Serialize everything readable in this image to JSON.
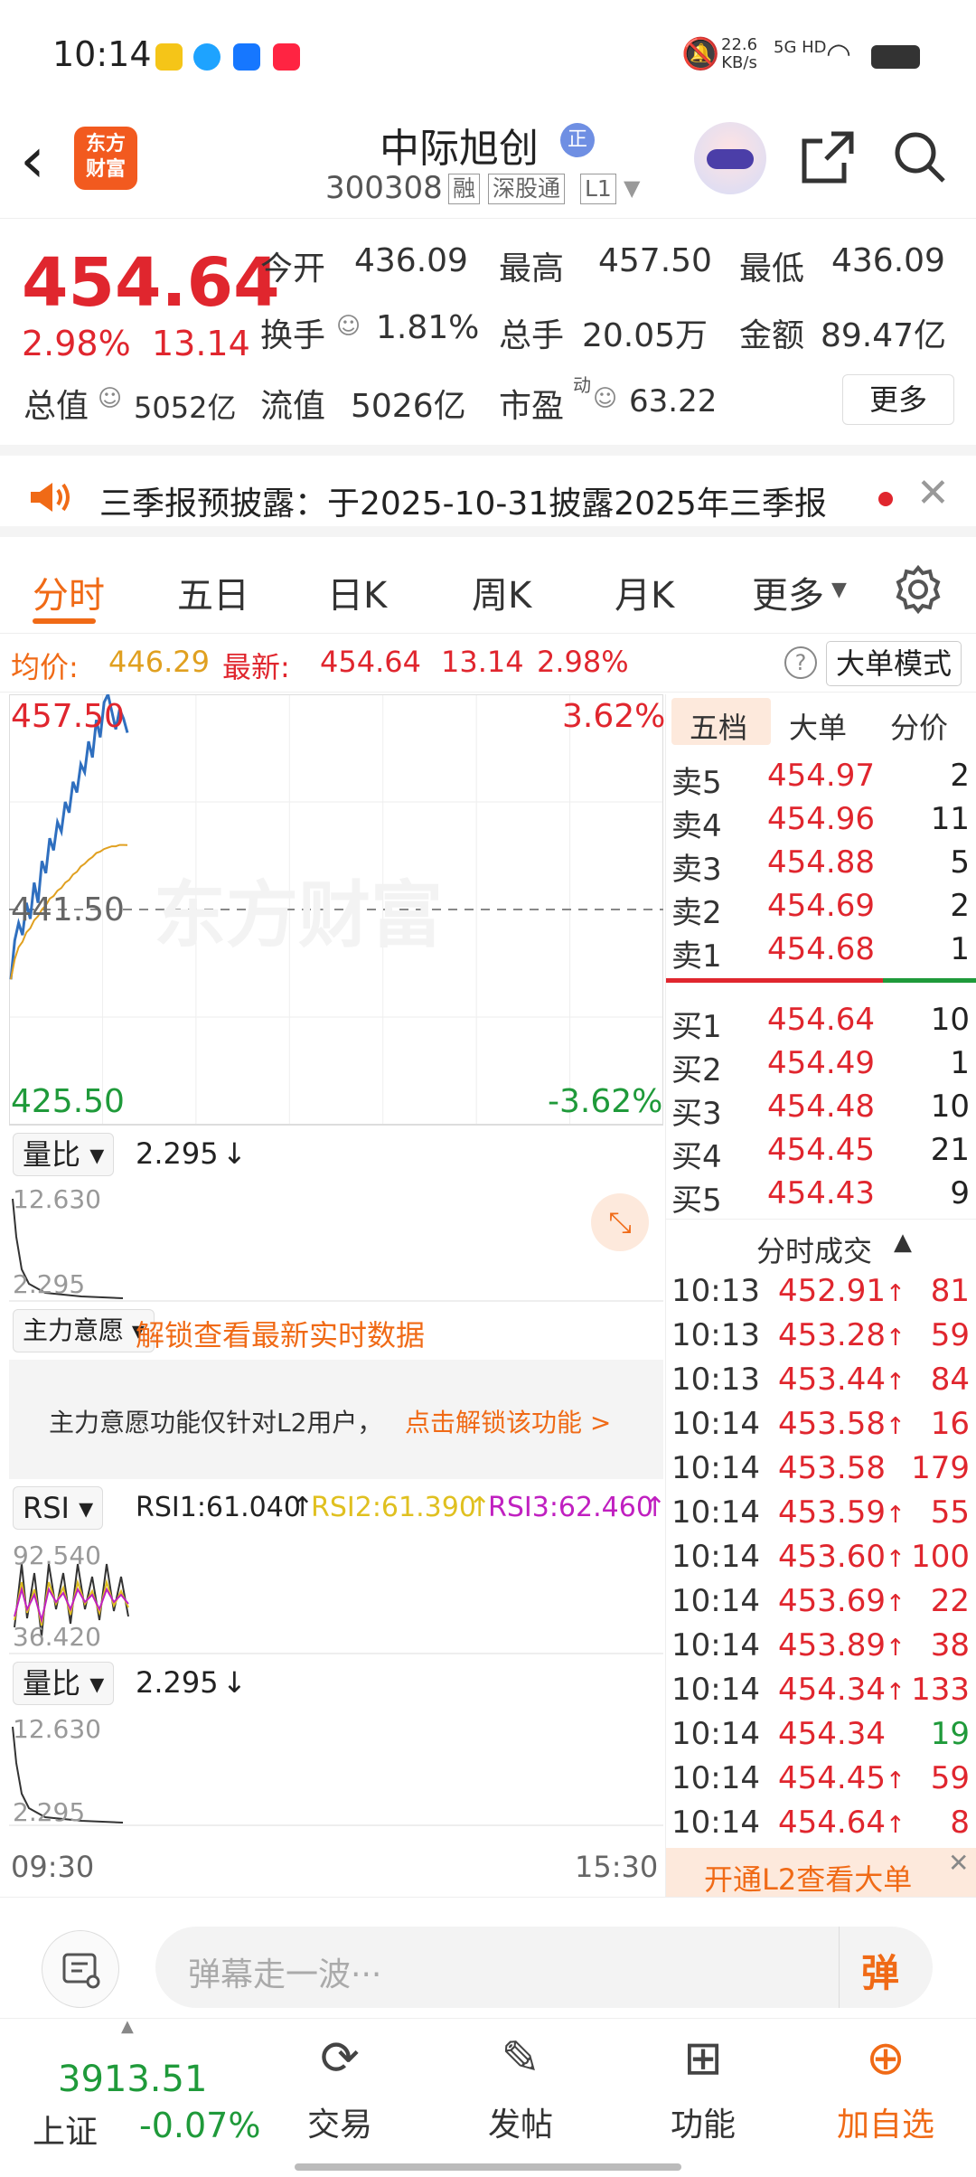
{
  "status_bar": {
    "time": "10:14",
    "net_speed_top": "22.6",
    "net_speed_bottom": "KB/s",
    "network": "5G HD"
  },
  "header": {
    "back_icon": "back-arrow-icon",
    "logo_line1": "东方",
    "logo_line2": "财富",
    "stock_name": "中际旭创",
    "zheng_badge": "正",
    "stock_code": "300308",
    "tags": [
      "融",
      "深股通",
      "L1"
    ]
  },
  "quote": {
    "price": "454.64",
    "change_pct": "2.98%",
    "change_amt": "13.14",
    "open_label": "今开",
    "open_value": "436.09",
    "high_label": "最高",
    "high_value": "457.50",
    "low_label": "最低",
    "low_value": "436.09",
    "turnover_label": "换手",
    "turnover_value": "1.81%",
    "volume_label": "总手",
    "volume_value": "20.05万",
    "amount_label": "金额",
    "amount_value": "89.47亿",
    "total_cap_label": "总值",
    "total_cap_value": "5052亿",
    "float_cap_label": "流值",
    "float_cap_value": "5026亿",
    "pe_label": "市盈",
    "pe_sup": "动",
    "pe_value": "63.22",
    "more_label": "更多"
  },
  "notice": {
    "text": "三季报预披露：于2025-10-31披露2025年三季报"
  },
  "tabs": [
    "分时",
    "五日",
    "日K",
    "周K",
    "月K",
    "更多"
  ],
  "info_line": {
    "avg_label": "均价:",
    "avg_value": "446.29",
    "latest_label": "最新:",
    "latest_value": "454.64",
    "latest_change": "13.14",
    "latest_pct": "2.98%",
    "big_order_mode": "大单模式"
  },
  "intraday_chart": {
    "price_top": "457.50",
    "pct_top": "3.62%",
    "price_mid": "441.50",
    "price_bottom": "425.50",
    "pct_bottom": "-3.62%",
    "watermark": "东方财富",
    "time_start": "09:30",
    "time_end": "15:30"
  },
  "chart_data": {
    "type": "line",
    "title": "",
    "ylim": [
      425.5,
      457.5
    ],
    "series": [
      {
        "values": [
          436.3,
          439.2,
          440.5,
          439.6,
          442.0,
          440.8,
          443.5,
          442.0,
          445.1,
          444.2,
          446.8,
          445.9,
          448.0,
          447.3,
          449.5,
          448.7,
          451.0,
          450.2,
          452.3,
          451.7,
          454.0,
          452.8,
          455.6,
          454.3,
          456.9,
          457.5,
          456.2,
          454.9,
          456.4,
          455.7,
          454.64
        ]
      },
      {
        "values": [
          436.3,
          437.8,
          438.7,
          439.1,
          439.8,
          440.1,
          440.7,
          441.0,
          441.5,
          441.8,
          442.3,
          442.5,
          442.9,
          443.1,
          443.5,
          443.7,
          444.1,
          444.3,
          444.7,
          444.9,
          445.2,
          445.4,
          445.7,
          445.8,
          446.0,
          446.1,
          446.2,
          446.2,
          446.3,
          446.3,
          446.29
        ]
      }
    ]
  },
  "volume_ratio_panel": {
    "label": "量比",
    "value": "2.295",
    "max_label": "12.630",
    "min_label": "2.295"
  },
  "main_intent_panel": {
    "label": "主力意愿",
    "unlock_text": "解锁查看最新实时数据",
    "l2_note": "主力意愿功能仅针对L2用户，",
    "l2_link": "点击解锁该功能 >"
  },
  "rsi_panel": {
    "label": "RSI",
    "rsi1": "RSI1:61.040",
    "rsi2": "RSI2:61.390",
    "rsi3": "RSI3:62.460",
    "max_label": "92.540",
    "min_label": "36.420"
  },
  "volume_ratio_panel2": {
    "label": "量比",
    "value": "2.295",
    "max_label": "12.630",
    "min_label": "2.295"
  },
  "orderbook": {
    "tabs": [
      "五档",
      "大单",
      "分价"
    ],
    "asks": [
      {
        "name": "卖5",
        "price": "454.97",
        "vol": "2"
      },
      {
        "name": "卖4",
        "price": "454.96",
        "vol": "11"
      },
      {
        "name": "卖3",
        "price": "454.88",
        "vol": "5"
      },
      {
        "name": "卖2",
        "price": "454.69",
        "vol": "2"
      },
      {
        "name": "卖1",
        "price": "454.68",
        "vol": "1"
      }
    ],
    "bids": [
      {
        "name": "买1",
        "price": "454.64",
        "vol": "10"
      },
      {
        "name": "买2",
        "price": "454.49",
        "vol": "1"
      },
      {
        "name": "买3",
        "price": "454.48",
        "vol": "10"
      },
      {
        "name": "买4",
        "price": "454.45",
        "vol": "21"
      },
      {
        "name": "买5",
        "price": "454.43",
        "vol": "9"
      }
    ],
    "trades_header": "分时成交",
    "trades": [
      {
        "time": "10:13",
        "price": "452.91",
        "arrow": "↑",
        "vol": "81",
        "side": "buy"
      },
      {
        "time": "10:13",
        "price": "453.28",
        "arrow": "↑",
        "vol": "59",
        "side": "buy"
      },
      {
        "time": "10:13",
        "price": "453.44",
        "arrow": "↑",
        "vol": "84",
        "side": "buy"
      },
      {
        "time": "10:14",
        "price": "453.58",
        "arrow": "↑",
        "vol": "16",
        "side": "buy"
      },
      {
        "time": "10:14",
        "price": "453.58",
        "arrow": "",
        "vol": "179",
        "side": "buy"
      },
      {
        "time": "10:14",
        "price": "453.59",
        "arrow": "↑",
        "vol": "55",
        "side": "buy"
      },
      {
        "time": "10:14",
        "price": "453.60",
        "arrow": "↑",
        "vol": "100",
        "side": "buy"
      },
      {
        "time": "10:14",
        "price": "453.69",
        "arrow": "↑",
        "vol": "22",
        "side": "buy"
      },
      {
        "time": "10:14",
        "price": "453.89",
        "arrow": "↑",
        "vol": "38",
        "side": "buy"
      },
      {
        "time": "10:14",
        "price": "454.34",
        "arrow": "↑",
        "vol": "133",
        "side": "buy"
      },
      {
        "time": "10:14",
        "price": "454.34",
        "arrow": "",
        "vol": "19",
        "side": "sell"
      },
      {
        "time": "10:14",
        "price": "454.45",
        "arrow": "↑",
        "vol": "59",
        "side": "buy"
      },
      {
        "time": "10:14",
        "price": "454.64",
        "arrow": "↑",
        "vol": "8",
        "side": "buy"
      }
    ],
    "l2_banner": "开通L2查看大单"
  },
  "danmu": {
    "placeholder": "弹幕走一波···",
    "send_label": "弹"
  },
  "bottom_nav": {
    "index_value": "3913.51",
    "index_name": "上证",
    "index_change": "-0.07%",
    "items": [
      "交易",
      "发帖",
      "功能",
      "加自选"
    ]
  },
  "colors": {
    "up": "#e0262e",
    "down": "#1f9a3a",
    "accent": "#f06a16"
  }
}
